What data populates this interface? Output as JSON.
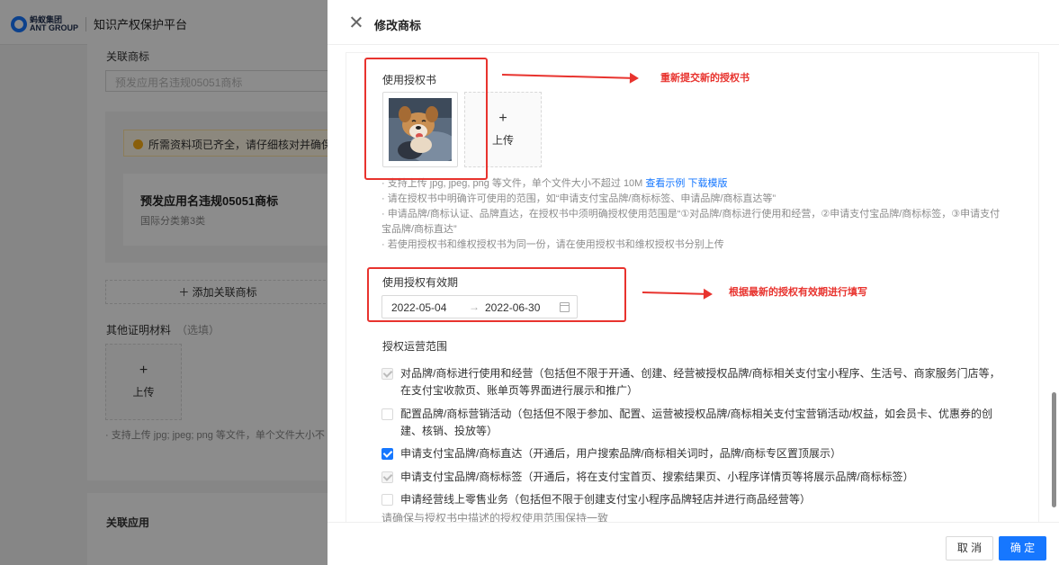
{
  "header": {
    "brand_cn": "蚂蚁集团",
    "brand_en": "ANT GROUP",
    "platform": "知识产权保护平台"
  },
  "background": {
    "related_tm_label": "关联商标",
    "related_tm_placeholder": "预发应用名违规05051商标",
    "notice": "所需资料项已齐全，请仔细核对并确保",
    "tm_name": "预发应用名违规05051商标",
    "tm_class": "国际分类第3类",
    "add_related": "＋  添加关联商标",
    "other_docs": "其他证明材料",
    "optional": "（选填）",
    "upload_plus": "+",
    "upload_label": "上传",
    "hint": "· 支持上传 jpg; jpeg; png 等文件，单个文件大小不",
    "section2": "关联应用"
  },
  "drawer": {
    "title": "修改商标",
    "auth_title": "使用授权书",
    "upload_plus": "+",
    "upload_label": "上传",
    "hints": {
      "h1_prefix": "· 支持上传 jpg, jpeg, png 等文件，单个文件大小不超过 10M ",
      "view_example": "查看示例",
      "download_template": "下载模版",
      "h2": "· 请在授权书中明确许可使用的范围，如“申请支付宝品牌/商标标签、申请品牌/商标直达等”",
      "h3": "· 申请品牌/商标认证、品牌直达，在授权书中须明确授权使用范围是“①对品牌/商标进行使用和经营，②申请支付宝品牌/商标标签，③申请支付宝品牌/商标直达”",
      "h4": "· 若使用授权书和维权授权书为同一份，请在使用授权书和维权授权书分别上传"
    },
    "validity_title": "使用授权有效期",
    "date_start": "2022-05-04",
    "date_arrow": "→",
    "date_end": "2022-06-30",
    "scope_title": "授权运营范围",
    "scope_items": [
      {
        "label": "对品牌/商标进行使用和经营（包括但不限于开通、创建、经营被授权品牌/商标相关支付宝小程序、生活号、商家服务门店等，在支付宝收款页、账单页等界面进行展示和推广）",
        "state": "checked-disabled"
      },
      {
        "label": "配置品牌/商标营销活动（包括但不限于参加、配置、运营被授权品牌/商标相关支付宝营销活动/权益，如会员卡、优惠券的创建、核销、投放等）",
        "state": "unchecked"
      },
      {
        "label": "申请支付宝品牌/商标直达（开通后，用户搜索品牌/商标相关词时，品牌/商标专区置顶展示）",
        "state": "checked"
      },
      {
        "label": "申请支付宝品牌/商标标签（开通后，将在支付宝首页、搜索结果页、小程序详情页等将展示品牌/商标标签）",
        "state": "checked-disabled"
      },
      {
        "label": "申请经营线上零售业务（包括但不限于创建支付宝小程序品牌轻店并进行商品经营等）",
        "state": "unchecked"
      }
    ],
    "scope_note": "请确保与授权书中描述的授权使用范围保持一致",
    "cancel": "取 消",
    "confirm": "确 定"
  },
  "annotations": {
    "note1": "重新提交新的授权书",
    "note2": "根据最新的授权有效期进行填写",
    "color": "#e8332e"
  },
  "colors": {
    "primary": "#1677ff",
    "mask": "rgba(0,0,0,0.45)"
  }
}
